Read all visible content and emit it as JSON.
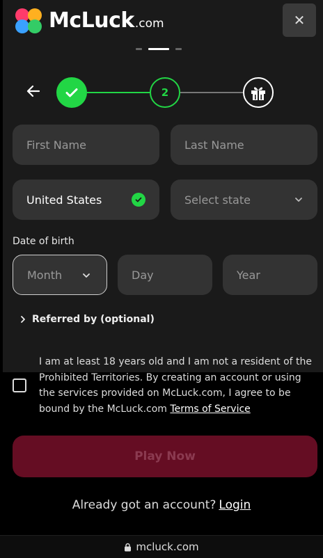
{
  "header": {
    "logo_name": "McLuck",
    "logo_suffix": ".com",
    "close_label": "✕"
  },
  "stepper": {
    "step2_label": "2",
    "current_step": 2,
    "total_steps": 3
  },
  "form": {
    "first_name_placeholder": "First Name",
    "last_name_placeholder": "Last Name",
    "country_value": "United States",
    "state_placeholder": "Select state",
    "dob_label": "Date of birth",
    "month_placeholder": "Month",
    "day_placeholder": "Day",
    "year_placeholder": "Year",
    "referred_label": "Referred by (optional)"
  },
  "terms": {
    "text": "I am at least 18 years old and I am not a resident of the Prohibited Territories. By creating an account or using the services provided on McLuck.com, I agree to be bound by the McLuck.com ",
    "link_label": "Terms of Service",
    "checked": false
  },
  "actions": {
    "play_label": "Play Now",
    "login_prompt": "Already got an account?",
    "login_link": "Login"
  },
  "browser": {
    "url": "mcluck.com"
  },
  "colors": {
    "accent_green": "#22d645",
    "play_button_bg": "#650d23",
    "field_bg": "#333333"
  }
}
